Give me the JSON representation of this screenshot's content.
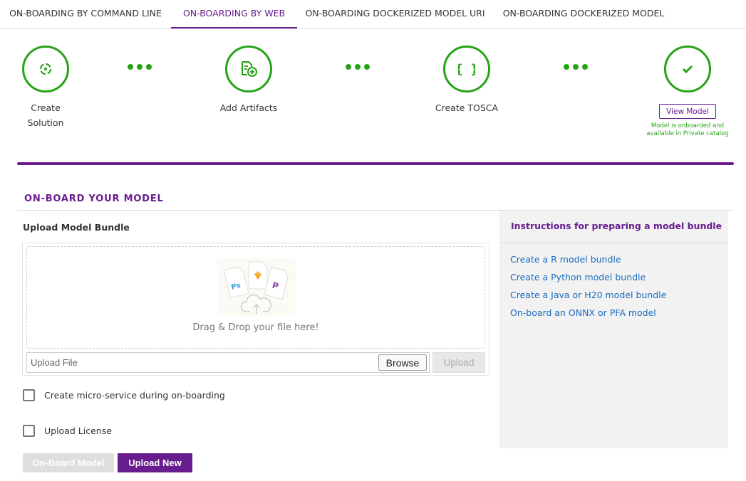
{
  "tabs": [
    {
      "label": "ON-BOARDING BY COMMAND LINE",
      "active": false
    },
    {
      "label": "ON-BOARDING BY WEB",
      "active": true
    },
    {
      "label": "ON-BOARDING DOCKERIZED MODEL URI",
      "active": false
    },
    {
      "label": "ON-BOARDING DOCKERIZED MODEL",
      "active": false
    }
  ],
  "steps": [
    {
      "label_line1": "Create",
      "label_line2": "Solution",
      "icon": "target-icon"
    },
    {
      "label": "Add Artifacts",
      "icon": "add-file-icon"
    },
    {
      "label": "Create TOSCA",
      "icon": "braces-icon"
    },
    {
      "icon": "checkmark-icon"
    }
  ],
  "view_model_label": "View Model",
  "onboarded_message": "Model is onboarded and available in Private catalog",
  "colors": {
    "accent": "#681d8f",
    "success": "#26a317",
    "link": "#1a6bbf"
  },
  "section_title": "ON-BOARD YOUR MODEL",
  "upload": {
    "title": "Upload Model Bundle",
    "drop_text": "Drag & Drop your file here!",
    "file_placeholder": "Upload File",
    "browse_label": "Browse",
    "upload_label": "Upload"
  },
  "options": {
    "microservice_label": "Create micro-service during on-boarding",
    "license_label": "Upload License"
  },
  "buttons": {
    "onboard_label": "On-Board Model",
    "upload_new_label": "Upload New"
  },
  "instructions": {
    "title": "Instructions for preparing a model bundle",
    "links": [
      "Create a R model bundle",
      "Create a Python model bundle",
      "Create a Java or H20 model bundle",
      "On-board an ONNX or PFA model"
    ]
  }
}
